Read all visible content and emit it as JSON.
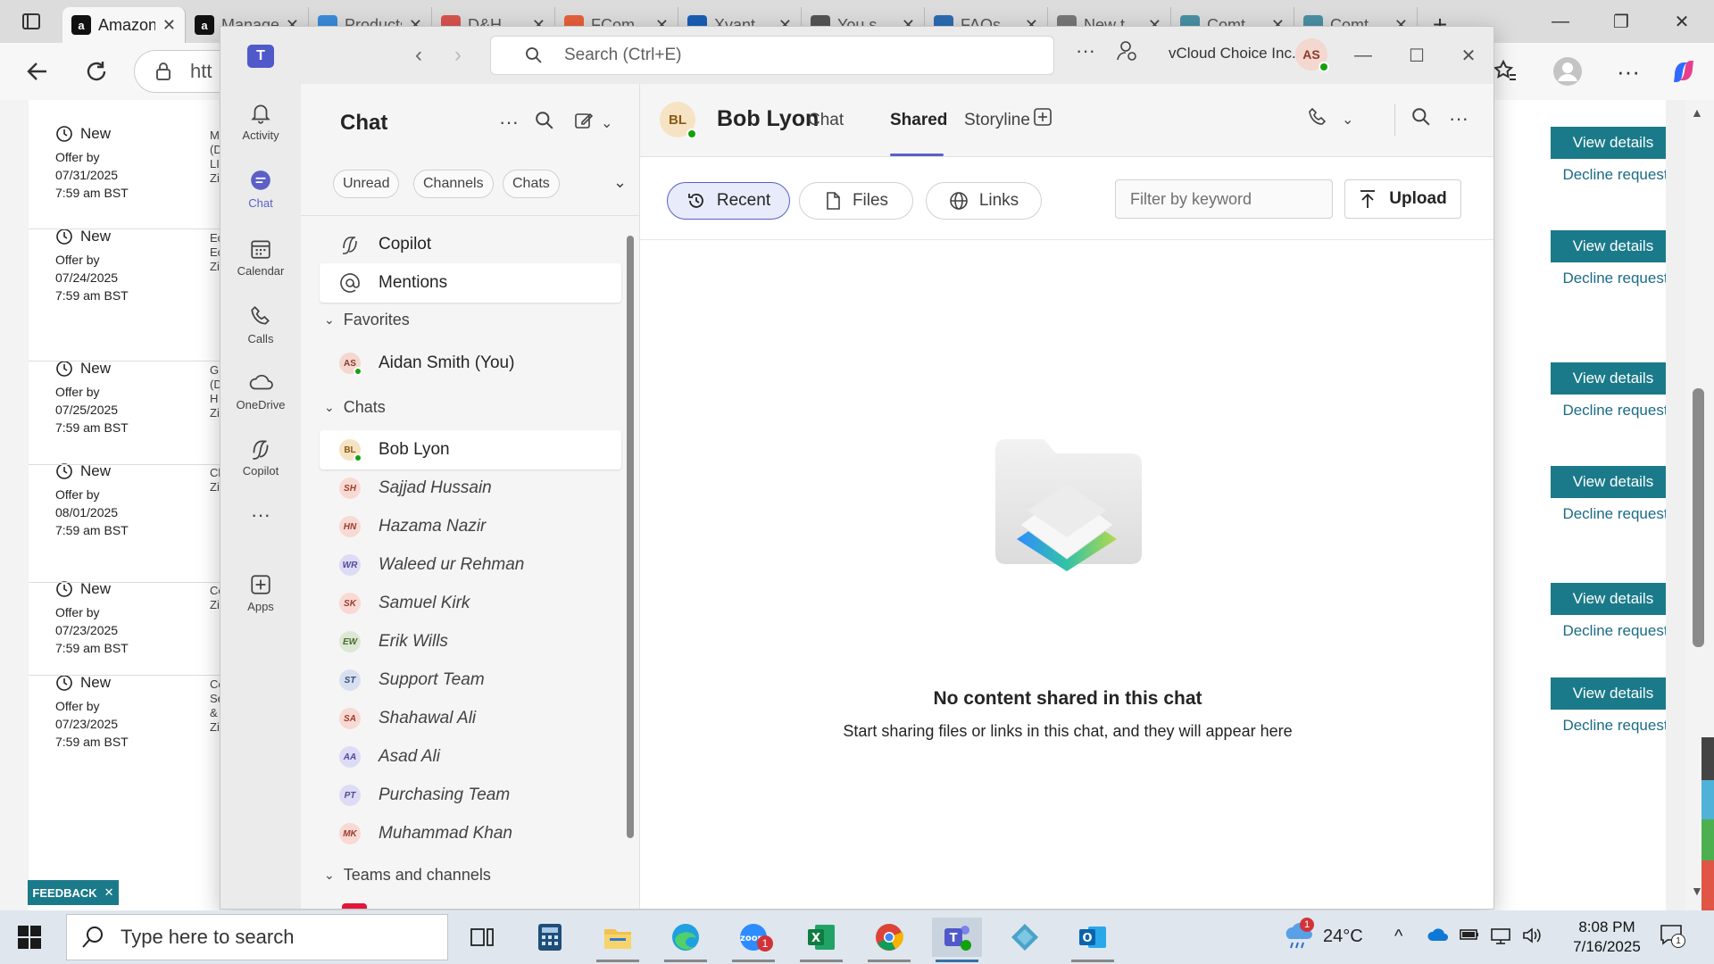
{
  "browser": {
    "tabs": [
      {
        "title": "Amazon",
        "icon_color": "#111111",
        "icon_glyph": "a"
      },
      {
        "title": "Manage",
        "icon_color": "#111111",
        "icon_glyph": "a"
      },
      {
        "title": "Products",
        "icon_color": "#3b8bd9",
        "icon_glyph": ""
      },
      {
        "title": "D&H",
        "icon_color": "#d9534f",
        "icon_glyph": ""
      },
      {
        "title": "FCom",
        "icon_color": "#e8603c",
        "icon_glyph": ""
      },
      {
        "title": "Xvant",
        "icon_color": "#1a5fb4",
        "icon_glyph": ""
      },
      {
        "title": "You s",
        "icon_color": "#555555",
        "icon_glyph": ""
      },
      {
        "title": "FAQs",
        "icon_color": "#2b6cb0",
        "icon_glyph": ""
      },
      {
        "title": "New t",
        "icon_color": "#777777",
        "icon_glyph": ""
      },
      {
        "title": "Comt",
        "icon_color": "#4a90a4",
        "icon_glyph": ""
      },
      {
        "title": "Comt",
        "icon_color": "#4a90a4",
        "icon_glyph": ""
      }
    ],
    "address_partial": "htt"
  },
  "background_page": {
    "offers": [
      {
        "status": "New",
        "offer_by": "Offer by",
        "date": "07/31/2025",
        "time": "7:59 am BST",
        "cut": [
          "M",
          "(D",
          "LI",
          "Zi"
        ]
      },
      {
        "status": "New",
        "offer_by": "Offer by",
        "date": "07/24/2025",
        "time": "7:59 am BST",
        "cut": [
          "Ec",
          "Ec",
          "Zi"
        ]
      },
      {
        "status": "New",
        "offer_by": "Offer by",
        "date": "07/25/2025",
        "time": "7:59 am BST",
        "cut": [
          "G",
          "(D",
          "H",
          "Zi"
        ]
      },
      {
        "status": "New",
        "offer_by": "Offer by",
        "date": "08/01/2025",
        "time": "7:59 am BST",
        "cut": [
          "Cl",
          "Zi"
        ]
      },
      {
        "status": "New",
        "offer_by": "Offer by",
        "date": "07/23/2025",
        "time": "7:59 am BST",
        "cut": [
          "Cc",
          "Zi"
        ]
      },
      {
        "status": "New",
        "offer_by": "Offer by",
        "date": "07/23/2025",
        "time": "7:59 am BST",
        "cut": [
          "Cc",
          "Se",
          "&",
          "Zi"
        ]
      }
    ],
    "view_details": "View details",
    "decline_request": "Decline request",
    "feedback": "FEEDBACK",
    "accent": "#1b7a8a"
  },
  "teams": {
    "search_placeholder": "Search (Ctrl+E)",
    "org_name": "vCloud Choice Inc.",
    "user_initials": "AS",
    "rail": [
      {
        "label": "Activity",
        "icon": "bell-icon"
      },
      {
        "label": "Chat",
        "icon": "chat-icon"
      },
      {
        "label": "Calendar",
        "icon": "calendar-icon"
      },
      {
        "label": "Calls",
        "icon": "phone-icon"
      },
      {
        "label": "OneDrive",
        "icon": "cloud-icon"
      },
      {
        "label": "Copilot",
        "icon": "copilot-icon"
      },
      {
        "label": "Apps",
        "icon": "plus-square-icon"
      }
    ],
    "chat_list": {
      "title": "Chat",
      "filters": [
        "Unread",
        "Channels",
        "Chats"
      ],
      "pinned": [
        {
          "label": "Copilot"
        },
        {
          "label": "Mentions"
        }
      ],
      "favorites_label": "Favorites",
      "favorites": [
        {
          "name": "Aidan Smith (You)",
          "initials": "AS",
          "color": "#f4d7cf",
          "text_color": "#8a3a2a"
        }
      ],
      "chats_label": "Chats",
      "chats": [
        {
          "name": "Bob Lyon",
          "initials": "BL",
          "color": "#f6e3c4",
          "text_color": "#8a5a14"
        },
        {
          "name": "Sajjad Hussain",
          "initials": "SH",
          "color": "#f9d9d3",
          "text_color": "#9a3d2f"
        },
        {
          "name": "Hazama Nazir",
          "initials": "HN",
          "color": "#f9d9d3",
          "text_color": "#9a3d2f"
        },
        {
          "name": "Waleed ur Rehman",
          "initials": "WR",
          "color": "#dedcf5",
          "text_color": "#4f4a9a"
        },
        {
          "name": "Samuel Kirk",
          "initials": "SK",
          "color": "#f9d9d3",
          "text_color": "#9a3d2f"
        },
        {
          "name": "Erik Wills",
          "initials": "EW",
          "color": "#dde8d4",
          "text_color": "#4a6a30"
        },
        {
          "name": "Support Team",
          "initials": "ST",
          "color": "#d8e0f0",
          "text_color": "#3a4e7a"
        },
        {
          "name": "Shahawal Ali",
          "initials": "SA",
          "color": "#f9d9d3",
          "text_color": "#9a3d2f"
        },
        {
          "name": "Asad Ali",
          "initials": "AA",
          "color": "#dedcf5",
          "text_color": "#4f4a9a"
        },
        {
          "name": "Purchasing Team",
          "initials": "PT",
          "color": "#dedcf5",
          "text_color": "#4f4a9a"
        },
        {
          "name": "Muhammad Khan",
          "initials": "MK",
          "color": "#f9d9d3",
          "text_color": "#9a3d2f"
        }
      ],
      "teams_label": "Teams and channels"
    },
    "conversation": {
      "name": "Bob Lyon",
      "initials": "BL",
      "tabs": [
        "Chat",
        "Shared",
        "Storyline"
      ],
      "active_tab": "Shared",
      "filters": [
        "Recent",
        "Files",
        "Links"
      ],
      "filter_placeholder": "Filter by keyword",
      "upload_label": "Upload",
      "empty_title": "No content shared in this chat",
      "empty_subtitle": "Start sharing files or links in this chat, and they will appear here",
      "accent": "#5b5fc7"
    }
  },
  "taskbar": {
    "search_placeholder": "Type here to search",
    "weather": "24°C",
    "time": "8:08 PM",
    "date": "7/16/2025",
    "zoom_badge": "1",
    "weather_badge": "1",
    "notification_badge": "1"
  }
}
